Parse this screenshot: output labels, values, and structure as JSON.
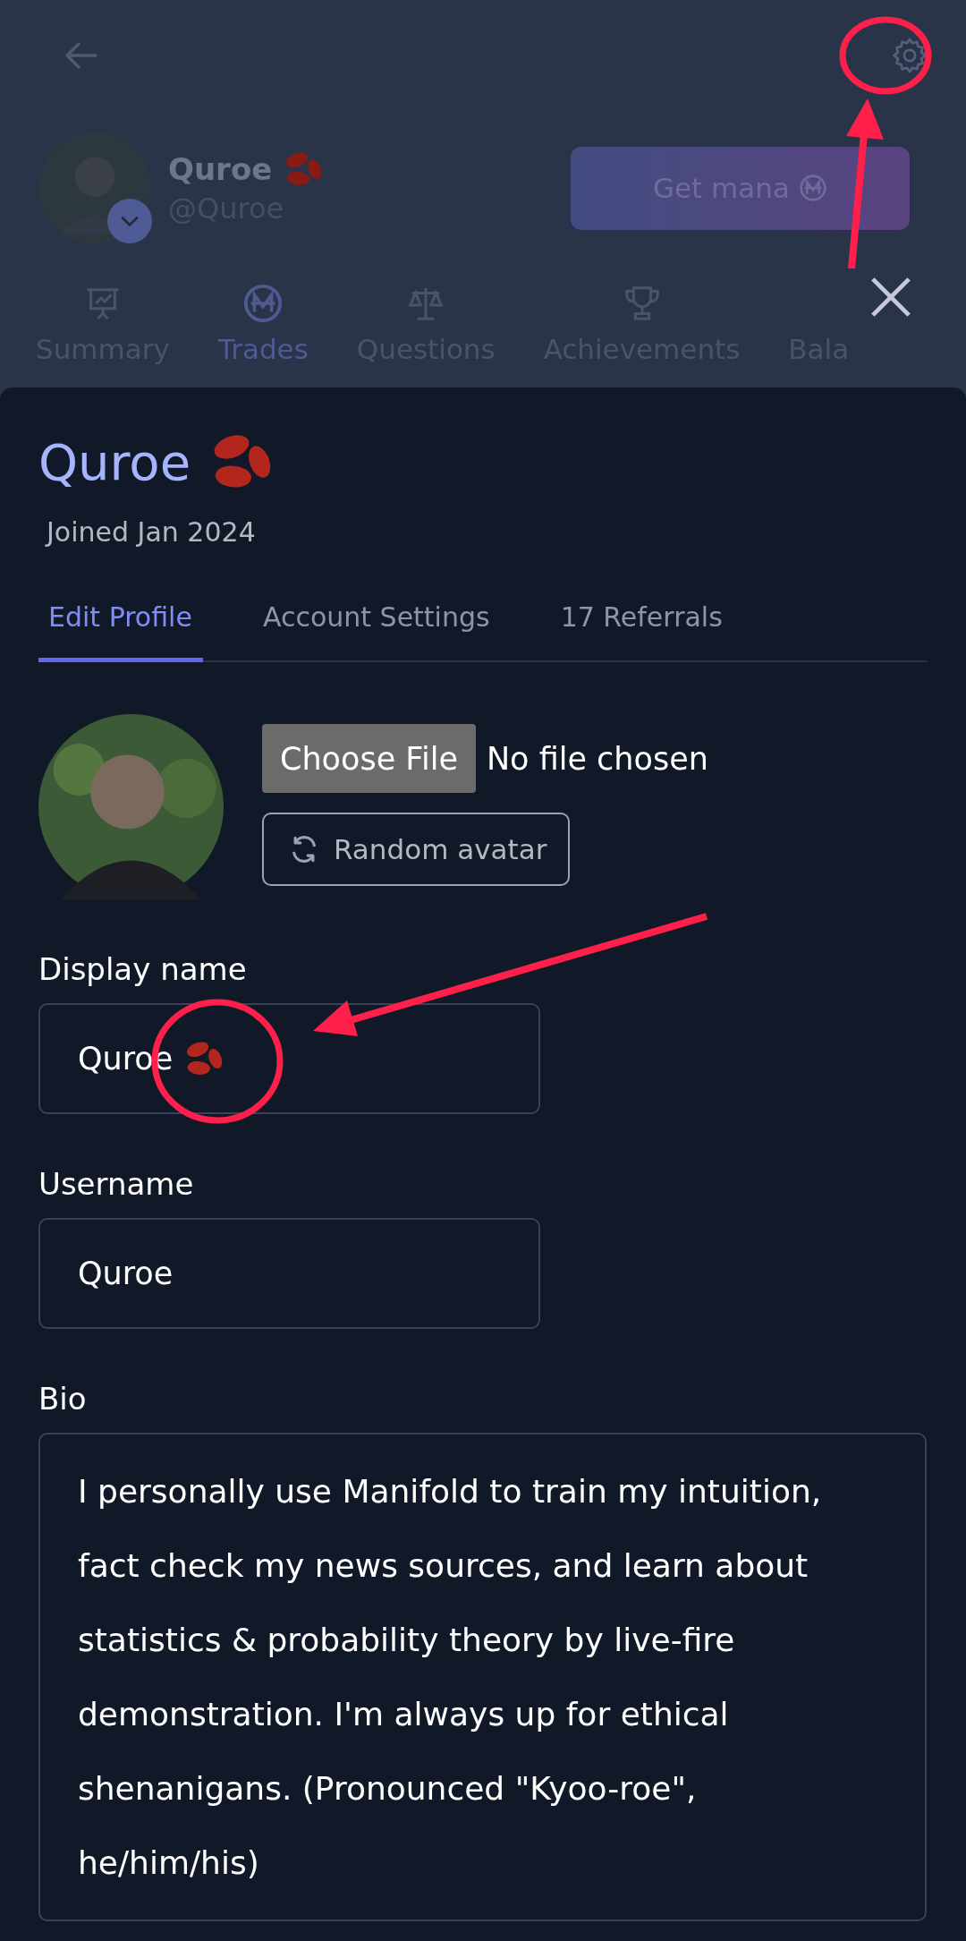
{
  "header": {
    "name": "Quroe",
    "name_beans": true,
    "handle": "@Quroe",
    "get_mana": "Get mana",
    "tabs": [
      {
        "label": "Summary",
        "selected": false
      },
      {
        "label": "Trades",
        "selected": true
      },
      {
        "label": "Questions",
        "selected": false
      },
      {
        "label": "Achievements",
        "selected": false
      },
      {
        "label": "Bala",
        "selected": false
      }
    ]
  },
  "sheet": {
    "title": "Quroe",
    "title_beans": true,
    "joined": "Joined Jan 2024",
    "tabs": [
      {
        "label": "Edit Profile",
        "selected": true
      },
      {
        "label": "Account Settings",
        "selected": false
      },
      {
        "label": "17 Referrals",
        "selected": false
      }
    ],
    "choose_file": "Choose File",
    "file_status": "No file chosen",
    "random_avatar": "Random avatar",
    "fields": [
      {
        "kind": "input",
        "label": "Display name",
        "value": "Quroe",
        "beans": true
      },
      {
        "kind": "input",
        "label": "Username",
        "value": "Quroe",
        "beans": false
      },
      {
        "kind": "textarea",
        "label": "Bio",
        "value": "I personally use Manifold to train my intuition, fact check my news sources, and learn about statistics & probability theory by live-fire demonstration. I'm always up for ethical shenanigans. (Pronounced \"Kyoo-roe\", he/him/his)",
        "beans": false
      }
    ]
  }
}
